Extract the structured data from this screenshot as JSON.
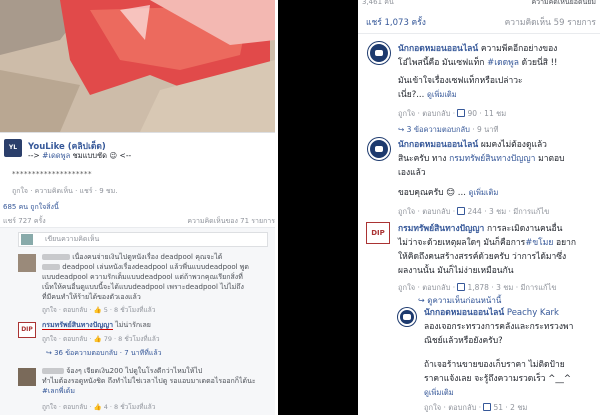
{
  "left": {
    "post": {
      "page_name": "YouLike",
      "page_suffix": "(คลิปเด็ด)",
      "post_prefix": "-->",
      "hashtag": "#เดดพูล",
      "post_rest": "ชมแบบชัด 😉 <--",
      "stars": "********************",
      "actions": "ถูกใจ · ความคิดเห็น · แชร์ · 9 ชม."
    },
    "stats": {
      "likes": "685 คน ถูกใจสิ่งนี้"
    },
    "shares": {
      "count": "แชร์ 727 ครั้ง",
      "views": "ความคิดเห็นของ 71 รายการ"
    },
    "comment_placeholder": "เขียนความคิดเห็น",
    "comment1": {
      "line1": "เนื่องคนจ่ายเงินไปดูหนังเรื่อง deadpool คุณจะได้",
      "line2": "deadpool เล่นหนังเรื่องdeadpool แล้วพี่นแบบdeadpool พูด",
      "line3": "แบบdeadpool ความรักเต็มแบบdeadpool แต่ถ้าพวกคุณเรียกสิ่งที่",
      "line4": "เน็ทให้คนอื่นดูแบบนี้จะได้แบบdeadpool เพราะdeadpool ไปไม่ถึง",
      "line5": "ที่มีคนทำให้ร้ายได้ของตัวเองแล้ว",
      "meta": "ถูกใจ · ตอบกลับ · 👍 5 · 8 ชั่วโมงที่แล้ว"
    },
    "comment2": {
      "badge": "DIP",
      "name": "กรมทรัพย์สินทางปัญญา",
      "text": "ไม่น่ารักเลย",
      "meta": "ถูกใจ · ตอบกลับ · 👍 79 · 8 ชั่วโมงที่แล้ว"
    },
    "comment2_replies": "↪ 36 ข้อความตอบกลับ · 7 นาทีที่แล้ว",
    "comment3": {
      "line1": "จ้องๆ เจียดเงิน200 ไปดูในโรงดีกว่าไหมให้ไป",
      "line2": "ทำไมต้องรอดูหนังชิด ถึงทำไม่ใช่เวลาไปดู รอแอบมาเดดอไรออกก็ได้นะ",
      "line3": "#เลกพี่เด้ม",
      "meta": "ถูกใจ · ตอบกลับ · 👍 4 · 8 ชั่วโมงที่แล้ว"
    }
  },
  "right": {
    "top_left": "3,461 คน",
    "top_right": "ความคิดเห็นยอดนิยม",
    "shares": "แชร์ 1,073 ครั้ง",
    "comments_count": "ความคิดเห็น 59 รายการ",
    "c1": {
      "name": "นักกอดหมอนออนไลน์",
      "inline": "ความพีคอีกอย่างของ",
      "line2_a": "โอ๋ไพสนี้คือ มันเซฟแท็ก ",
      "line2_tag": "#เดดพูล",
      "line2_b": " ด้วยนี่สิ !!",
      "q1": "มันเข้าใจเรื่องเซฟแท็กหรือเปล่าวะ",
      "q2": "เนี่ย?...",
      "more": "ดูเพิ่มเติม",
      "meta_a": "ถูกใจ · ตอบกลับ · ",
      "likes": "90",
      "meta_b": " · 11 ชม",
      "replies": "↪ 3 ข้อความตอบกลับ",
      "replies_time": " · 9 นาที"
    },
    "c2": {
      "name": "นักกอดหมอนออนไลน์",
      "inline": "ผมคงไม่ต้องดูแล้ว",
      "line2_a": "สินะครับ ทาง ",
      "line2_link": "กรมทรัพย์สินทางปัญญา",
      "line2_b": " มาตอบ",
      "line3": "เองแล้ว",
      "thanks": "ขอบคุณครับ 😊 ...",
      "more": "ดูเพิ่มเติม",
      "meta_a": "ถูกใจ · ตอบกลับ · ",
      "likes": "244",
      "meta_b": " · 3 ชม · มีการแก้ไข"
    },
    "c3": {
      "badge": "DIP",
      "name": "กรมทรัพย์สินทางปัญญา",
      "inline": "การละเมิดงานคนอื่น",
      "line2": "ไม่ว่าจะด้วยเหตุผลใดๆ มันก็คือการ",
      "line2_tag": "#ขโมย",
      "line2_b": " อยาก",
      "line3": "ให้คิดถึงคนสร้างสรรค์ด้วยครับ ว่าการได้มาซึ่ง",
      "line4": "ผลงานนั้น มันก็ไม่ง่ายเหมือนกัน",
      "meta_a": "ถูกใจ · ตอบกลับ · ",
      "likes": "1,878",
      "meta_b": " · 3 ชม · มีการแก้ไข"
    },
    "view_prev": "↪ ดูความเห็นก่อนหน้านี้",
    "c4": {
      "name": "นักกอดหมอนออนไลน์",
      "reply_to": "Peachy Kark",
      "l1": "ลองเจอกระทรวงการคลังและกระทรวงพา",
      "l2": "ณิชย์แล้วหรือยังครับ?",
      "l3": "ถ้าเจอร้านขายของเก็บราคา ไม่ติดป้าย",
      "l4": "ราคาแจ้งเลย จะรู้ถึงความรวดเร็ว ^__^",
      "more": "ดูเพิ่มเติม",
      "meta_a": "ถูกใจ · ตอบกลับ · ",
      "likes": "51",
      "meta_b": " · 2 ชม"
    }
  },
  "colors": {
    "link": "#365899",
    "muted": "#90949c",
    "divider": "#000000"
  }
}
